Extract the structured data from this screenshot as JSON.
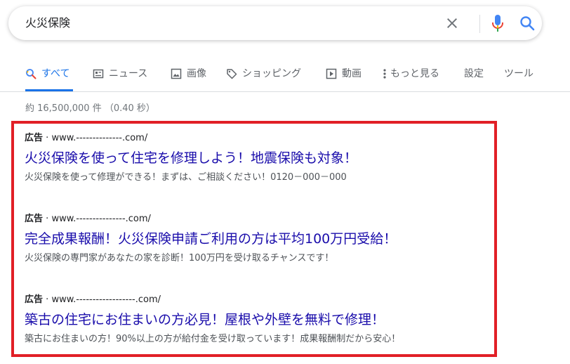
{
  "search": {
    "query": "火災保険"
  },
  "tabs": [
    {
      "label": "すべて",
      "icon": "search-icon",
      "active": true
    },
    {
      "label": "ニュース",
      "icon": "news-icon"
    },
    {
      "label": "画像",
      "icon": "image-icon"
    },
    {
      "label": "ショッピング",
      "icon": "tag-icon"
    },
    {
      "label": "動画",
      "icon": "play-icon"
    },
    {
      "label": "もっと見る",
      "icon": "more-vert-icon"
    },
    {
      "label": "設定"
    },
    {
      "label": "ツール"
    }
  ],
  "result_stats": "約 16,500,000 件 （0.40 秒）",
  "ads": [
    {
      "badge": "広告",
      "separator": "·",
      "url": "www.--------------.com/",
      "title": "火災保険を使って住宅を修理しよう！地震保険も対象！",
      "description": "火災保険を使って修理ができる！まずは、ご相談ください！0120－000－000"
    },
    {
      "badge": "広告",
      "separator": "·",
      "url": "www.---------------.com/",
      "title": "完全成果報酬！火災保険申請ご利用の方は平均100万円受給！",
      "description": "火災保険の専門家があなたの家を診断！100万円を受け取るチャンスです！"
    },
    {
      "badge": "広告",
      "separator": "·",
      "url": "www.------------------.com/",
      "title": "築古の住宅にお住まいの方必見！屋根や外壁を無料で修理！",
      "description": "築古にお住まいの方！90%以上の方が給付金を受け取っています！成果報酬制だから安心！"
    }
  ],
  "colors": {
    "accent": "#1a73e8",
    "link": "#1a0dab",
    "highlight_frame": "#e11f26"
  }
}
